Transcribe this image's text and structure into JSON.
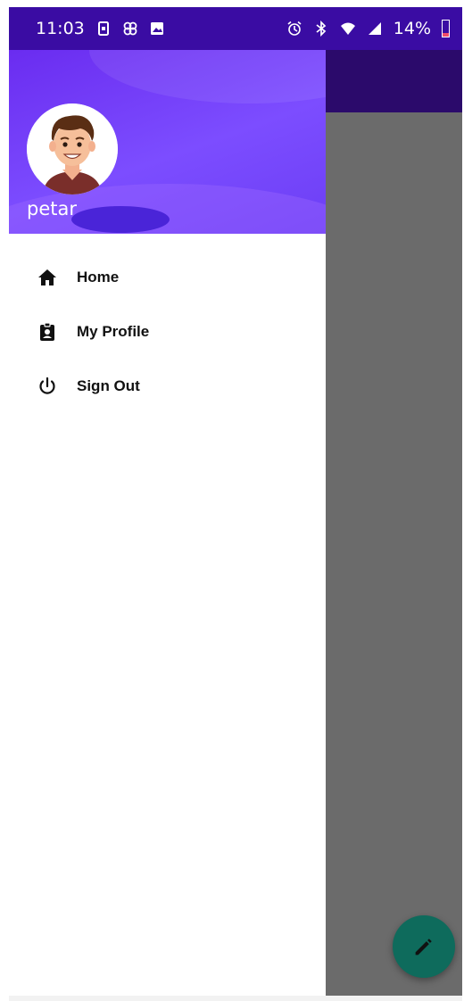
{
  "status_bar": {
    "time": "11:03",
    "battery": "14%",
    "left_icons": [
      "sim-card-icon",
      "pinwheel-icon",
      "image-icon"
    ],
    "right_icons": [
      "alarm-icon",
      "bluetooth-icon",
      "wifi-icon",
      "signal-icon",
      "battery-icon"
    ]
  },
  "drawer": {
    "header": {
      "username": "petar",
      "avatar": "avatar-cartoon-man"
    },
    "items": [
      {
        "label": "Home",
        "icon": "home-icon"
      },
      {
        "label": "My Profile",
        "icon": "profile-badge-icon"
      },
      {
        "label": "Sign Out",
        "icon": "power-icon"
      }
    ]
  },
  "fab": {
    "icon": "edit-pencil-icon",
    "color": "#0e6b5c"
  },
  "colors": {
    "status_bar": "#3a0ca3",
    "header_gradient_start": "#6a2cf0",
    "header_gradient_end": "#7c4dff",
    "scrim": "#6b6b6b",
    "toolbar": "#2b0a6b"
  }
}
